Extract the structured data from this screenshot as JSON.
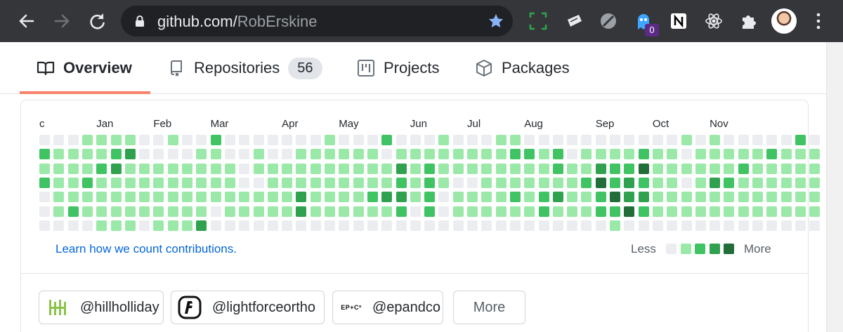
{
  "browser": {
    "url_host": "github.com/",
    "url_path": "RobErskine",
    "extension_badge": "0"
  },
  "tabs": [
    {
      "label": "Overview",
      "icon": "book-icon"
    },
    {
      "label": "Repositories",
      "icon": "repo-icon",
      "count": "56"
    },
    {
      "label": "Projects",
      "icon": "project-icon"
    },
    {
      "label": "Packages",
      "icon": "package-icon"
    }
  ],
  "contributions": {
    "months": [
      "c",
      "Jan",
      "Feb",
      "Mar",
      "Apr",
      "May",
      "Jun",
      "Jul",
      "Aug",
      "Sep",
      "Oct",
      "Nov"
    ],
    "learn_link": "Learn how we count contributions.",
    "legend_less": "Less",
    "legend_more": "More",
    "colors": [
      "#ebedf0",
      "#9be9a8",
      "#40c463",
      "#30a14e",
      "#216e39"
    ],
    "grid": [
      "0001111001002000000010002000100011000000000001010000020",
      "2111123000011001001111110111111112212011112110111112111",
      "1111231111111101111111111312111111112113224111111211111",
      "2112111111111100111111111212100111111124232110132111111",
      "0111111111111111113111123312011112123112433111111111111",
      "0121111111110111113111111202011111121112242111111111111",
      "0000111011130000000000000000000000000000100000000000000"
    ]
  },
  "orgs": [
    {
      "handle": "@hillholliday",
      "logo": "hill-holliday-logo"
    },
    {
      "handle": "@lightforceortho",
      "logo": "lightforce-logo"
    },
    {
      "handle": "@epandco",
      "logo": "epandco-logo",
      "logo_text": "EP+Cº"
    }
  ],
  "orgs_more_label": "More"
}
